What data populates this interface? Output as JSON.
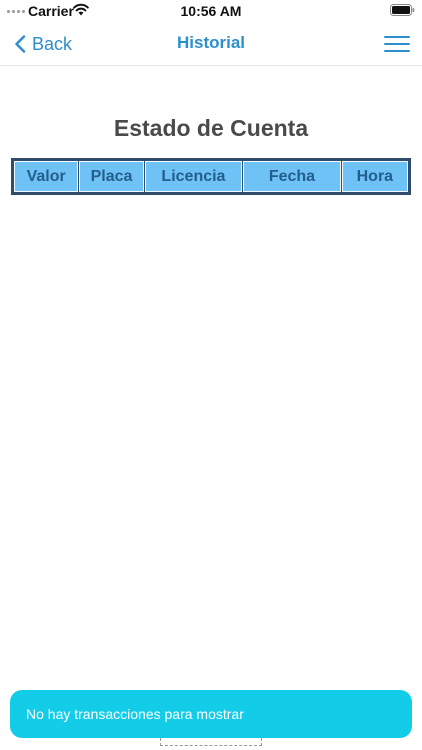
{
  "status_bar": {
    "carrier": "Carrier",
    "time": "10:56 AM"
  },
  "nav": {
    "back_label": "Back",
    "title": "Historial"
  },
  "page": {
    "title": "Estado de Cuenta"
  },
  "table": {
    "columns": [
      "Valor",
      "Placa",
      "Licencia",
      "Fecha",
      "Hora"
    ],
    "rows": []
  },
  "toast": {
    "message": "No hay transacciones para mostrar"
  },
  "colors": {
    "accent": "#2b8fce",
    "header_cell": "#6ec2f5",
    "header_border": "#2f4c6b",
    "toast_bg": "#13cde8"
  },
  "icons": [
    "signal-dots-icon",
    "wifi-icon",
    "battery-icon",
    "chevron-left-icon",
    "hamburger-menu-icon"
  ]
}
